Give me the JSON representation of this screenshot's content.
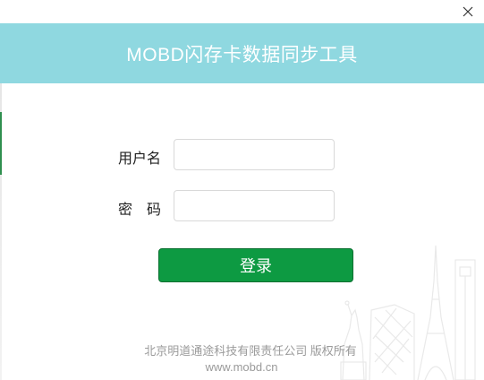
{
  "window": {
    "title": "MOBD闪存卡数据同步工具",
    "close_icon": "close-icon"
  },
  "form": {
    "username_label": "用户名",
    "username_value": "",
    "password_label": "密　码",
    "password_value": "",
    "login_label": "登录"
  },
  "footer": {
    "copyright": "北京明道通途科技有限责任公司 版权所有",
    "website": "www.mobd.cn"
  },
  "colors": {
    "banner": "#8fd8e0",
    "login_button": "#0d9a42"
  },
  "decor": {
    "background_art": "city-skyline-illustration"
  }
}
